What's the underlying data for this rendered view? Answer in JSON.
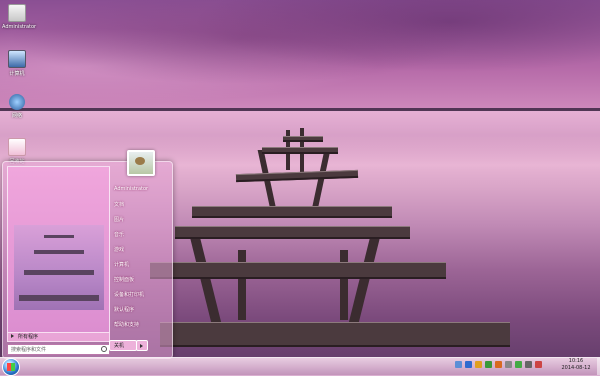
{
  "desktop": {
    "icons": [
      {
        "icon": "folder-icon",
        "label": "Administrator"
      },
      {
        "icon": "computer-icon",
        "label": "计算机"
      },
      {
        "icon": "network-icon",
        "label": "网络"
      },
      {
        "icon": "recycle-bin-icon",
        "label": "回收站"
      }
    ]
  },
  "start_menu": {
    "all_programs": "所有程序",
    "search_placeholder": "搜索程序和文件",
    "right_items": [
      "Administrator",
      "文档",
      "图片",
      "音乐",
      "游戏",
      "计算机",
      "控制面板",
      "设备和打印机",
      "默认程序",
      "帮助和支持"
    ],
    "shutdown_label": "关机"
  },
  "taskbar": {
    "time": "10:16",
    "date": "2014-08-12"
  },
  "colors": {
    "accent": "#d08bbd",
    "taskbar": "#e6c0dc"
  }
}
